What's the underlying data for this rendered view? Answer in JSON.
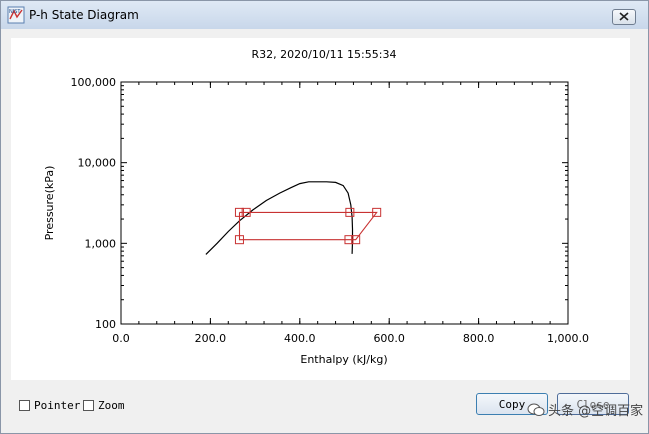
{
  "window": {
    "title": "P-h State Diagram",
    "app_icon_text": "NIST"
  },
  "chart_data": {
    "type": "line",
    "title": "R32, 2020/10/11 15:55:34",
    "xlabel": "Enthalpy (kJ/kg)",
    "ylabel": "Pressure(kPa)",
    "xlim": [
      0,
      1000
    ],
    "ylim": [
      100,
      100000
    ],
    "yscale": "log",
    "x_ticks": [
      {
        "value": 0,
        "label": "0.0"
      },
      {
        "value": 200,
        "label": "200.0"
      },
      {
        "value": 400,
        "label": "400.0"
      },
      {
        "value": 600,
        "label": "600.0"
      },
      {
        "value": 800,
        "label": "800.0"
      },
      {
        "value": 1000,
        "label": "1,000.0"
      }
    ],
    "y_ticks": [
      {
        "value": 100,
        "label": "100"
      },
      {
        "value": 1000,
        "label": "1,000"
      },
      {
        "value": 10000,
        "label": "10,000"
      },
      {
        "value": 100000,
        "label": "100,000"
      }
    ],
    "grid": false,
    "series": [
      {
        "role": "saturation-dome",
        "color": "#000000",
        "x": [
          190,
          215,
          240,
          265,
          295,
          325,
          355,
          380,
          400,
          420,
          440,
          460,
          480,
          497,
          508,
          514,
          517,
          518,
          518,
          517
        ],
        "y": [
          730,
          1000,
          1400,
          1900,
          2600,
          3400,
          4200,
          4900,
          5500,
          5800,
          5800,
          5800,
          5700,
          5200,
          4200,
          3000,
          2100,
          1500,
          1050,
          740
        ]
      },
      {
        "role": "refrigeration-cycle",
        "color": "#c83232",
        "marker": "square",
        "x": [
          265,
          280,
          512,
          572,
          525,
          510,
          265,
          265
        ],
        "y": [
          2420,
          2420,
          2420,
          2420,
          1110,
          1110,
          1110,
          2420
        ]
      }
    ]
  },
  "footer": {
    "pointer_label": "Pointer",
    "zoom_label": "Zoom",
    "copy_label": "Copy",
    "close_label": "Close",
    "watermark": "头条 @空调百家"
  }
}
